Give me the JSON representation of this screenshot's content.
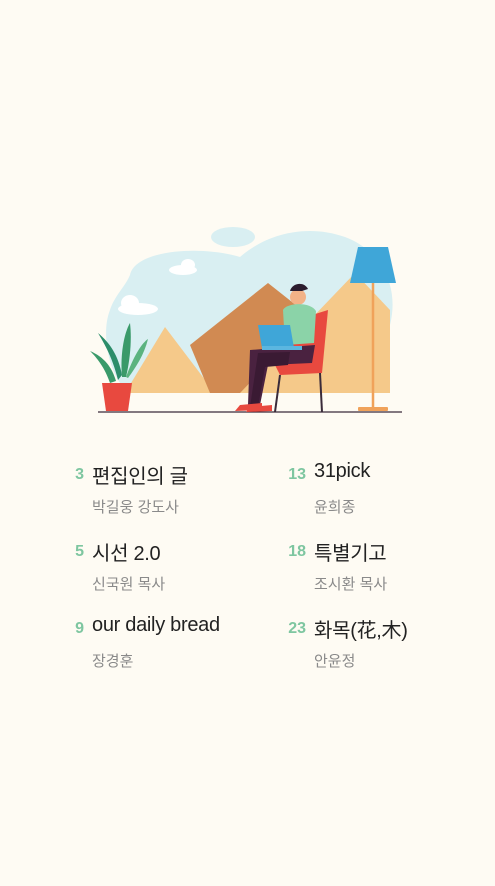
{
  "toc": [
    {
      "number": "3",
      "title": "편집인의 글",
      "author": "박길웅 강도사"
    },
    {
      "number": "13",
      "title": "31pick",
      "author": "윤희종"
    },
    {
      "number": "5",
      "title": "시선 2.0",
      "author": "신국원 목사"
    },
    {
      "number": "18",
      "title": "특별기고",
      "author": "조시환 목사"
    },
    {
      "number": "9",
      "title": "our daily bread",
      "author": "장경훈"
    },
    {
      "number": "23",
      "title": "화목(花,木)",
      "author": "안윤정"
    }
  ],
  "colors": {
    "background": "#fefbf3",
    "accent_number": "#7ec6a0",
    "title_text": "#222222",
    "author_text": "#8a8a8a"
  }
}
